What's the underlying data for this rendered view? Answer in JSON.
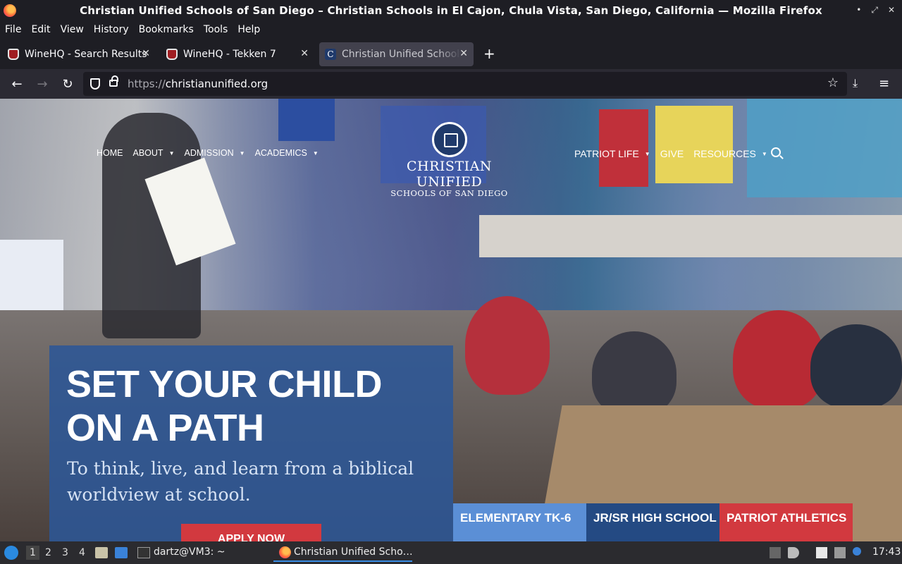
{
  "window": {
    "title": "Christian Unified Schools of San Diego – Christian Schools in El Cajon, Chula Vista, San Diego, California — Mozilla Firefox",
    "controls": [
      "•",
      "⤢",
      "✕"
    ]
  },
  "menu": [
    "File",
    "Edit",
    "View",
    "History",
    "Bookmarks",
    "Tools",
    "Help"
  ],
  "tabs": [
    {
      "label": "WineHQ - Search Results",
      "icon": "winehq-icon"
    },
    {
      "label": "WineHQ - Tekken 7",
      "icon": "winehq-icon"
    },
    {
      "label": "Christian Unified Schools of San Diego",
      "icon": "christian-unified-icon",
      "active": true
    }
  ],
  "newtab_label": "+",
  "nav": {
    "back": "←",
    "forward": "→",
    "reload": "↻",
    "url_protocol": "https://",
    "url_host": "christianunified.org",
    "star": "☆",
    "download": "⤓",
    "menu": "≡"
  },
  "site": {
    "nav_left": [
      "HOME",
      "ABOUT",
      "ADMISSION",
      "ACADEMICS"
    ],
    "nav_right": [
      "PATRIOT LIFE",
      "GIVE",
      "RESOURCES"
    ],
    "caret": "▼",
    "logo_line1": "CHRISTIAN UNIFIED",
    "logo_line2": "SCHOOLS OF SAN DIEGO",
    "hero_heading": "SET YOUR CHILD ON A PATH",
    "hero_sub": "To think, live, and learn from a biblical worldview at school.",
    "apply": "APPLY NOW",
    "pills": [
      {
        "label": "ELEMENTARY TK-6",
        "color": "#5b8fd6"
      },
      {
        "label": "JR/SR HIGH SCHOOL",
        "color": "#244a83"
      },
      {
        "label": "PATRIOT ATHLETICS",
        "color": "#d2393f"
      }
    ]
  },
  "taskbar": {
    "workspaces": [
      "1",
      "2",
      "3",
      "4"
    ],
    "terminal": "dartz@VM3: ~",
    "firefox": "Christian Unified Scho…",
    "clock": "17:43"
  }
}
